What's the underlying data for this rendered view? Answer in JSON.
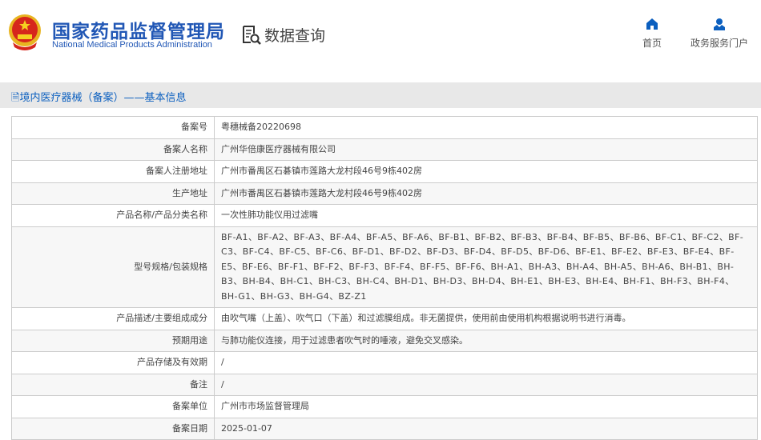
{
  "header": {
    "title_cn": "国家药品监督管理局",
    "title_en": "National Medical Products Administration",
    "data_query": "数据查询",
    "nav": [
      {
        "label": "首页",
        "icon": "home-icon"
      },
      {
        "label": "政务服务门户",
        "icon": "user-icon"
      }
    ]
  },
  "section_title": "境内医疗器械（备案）——基本信息",
  "rows": [
    {
      "label": "备案号",
      "value": "粤穗械备20220698"
    },
    {
      "label": "备案人名称",
      "value": "广州华倍康医疗器械有限公司"
    },
    {
      "label": "备案人注册地址",
      "value": "广州市番禺区石碁镇市莲路大龙村段46号9栋402房"
    },
    {
      "label": "生产地址",
      "value": "广州市番禺区石碁镇市莲路大龙村段46号9栋402房"
    },
    {
      "label": "产品名称/产品分类名称",
      "value": "一次性肺功能仪用过滤嘴"
    },
    {
      "label": "型号规格/包装规格",
      "value": "BF-A1、BF-A2、BF-A3、BF-A4、BF-A5、BF-A6、BF-B1、BF-B2、BF-B3、BF-B4、BF-B5、BF-B6、BF-C1、BF-C2、BF-C3、BF-C4、BF-C5、BF-C6、BF-D1、BF-D2、BF-D3、BF-D4、BF-D5、BF-D6、BF-E1、BF-E2、BF-E3、BF-E4、BF-E5、BF-E6、BF-F1、BF-F2、BF-F3、BF-F4、BF-F5、BF-F6、BH-A1、BH-A3、BH-A4、BH-A5、BH-A6、BH-B1、BH-B3、BH-B4、BH-C1、BH-C3、BH-C4、BH-D1、BH-D3、BH-D4、BH-E1、BH-E3、BH-E4、BH-F1、BH-F3、BH-F4、BH-G1、BH-G3、BH-G4、BZ-Z1"
    },
    {
      "label": "产品描述/主要组成成分",
      "value": "由吹气嘴（上盖）、吹气口（下盖）和过滤膜组成。非无菌提供，使用前由使用机构根据说明书进行消毒。"
    },
    {
      "label": "预期用途",
      "value": "与肺功能仪连接，用于过滤患者吹气时的唾液，避免交叉感染。"
    },
    {
      "label": "产品存储及有效期",
      "value": "/"
    },
    {
      "label": "备注",
      "value": "/"
    },
    {
      "label": "备案单位",
      "value": "广州市市场监督管理局"
    },
    {
      "label": "备案日期",
      "value": "2025-01-07"
    }
  ]
}
